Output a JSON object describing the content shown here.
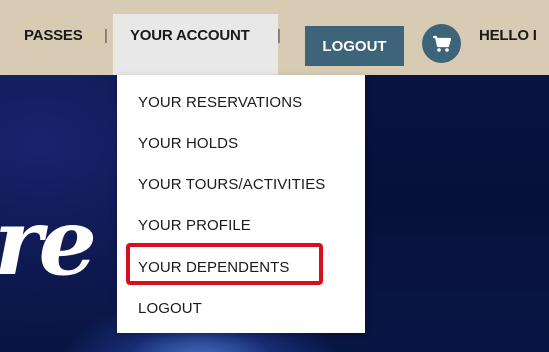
{
  "nav": {
    "passes": "PASSES",
    "separator": "|",
    "your_account": "YOUR ACCOUNT",
    "logout_button": "LOGOUT",
    "greeting": "HELLO I"
  },
  "icons": {
    "cart": "shopping-cart-icon"
  },
  "dropdown": {
    "items": [
      {
        "label": "YOUR RESERVATIONS"
      },
      {
        "label": "YOUR HOLDS"
      },
      {
        "label": "YOUR TOURS/ACTIVITIES"
      },
      {
        "label": "YOUR PROFILE"
      },
      {
        "label": "YOUR DEPENDENTS"
      },
      {
        "label": "LOGOUT"
      }
    ]
  },
  "hero": {
    "script_fragment": "re"
  },
  "colors": {
    "topbar": "#d8cbb4",
    "accent": "#3d6478",
    "highlight": "#d6101c",
    "hero_dark": "#07103a"
  }
}
